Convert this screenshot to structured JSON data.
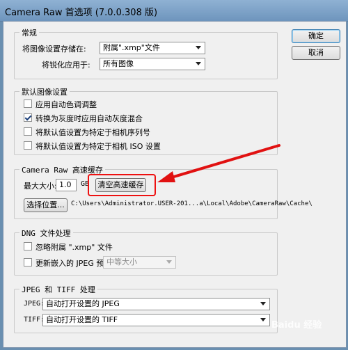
{
  "window": {
    "title": "Camera Raw 首选项 (7.0.0.308 版)"
  },
  "buttons": {
    "ok": "确定",
    "cancel": "取消"
  },
  "general": {
    "legend": "常规",
    "save_label": "将图像设置存储在:",
    "save_value": "附属\".xmp\"文件",
    "sharpen_label": "将锐化应用于:",
    "sharpen_value": "所有图像"
  },
  "defaults": {
    "legend": "默认图像设置",
    "items": [
      {
        "label": "应用自动色调调整",
        "checked": false
      },
      {
        "label": "转换为灰度时应用自动灰度混合",
        "checked": true
      },
      {
        "label": "将默认值设置为特定于相机序列号",
        "checked": false
      },
      {
        "label": "将默认值设置为特定于相机 ISO 设置",
        "checked": false
      }
    ]
  },
  "cache": {
    "legend": "Camera Raw 高速缓存",
    "max_size_label": "最大大小:",
    "max_size_value": "1.0",
    "unit": "GB",
    "purge_button": "清空高速缓存",
    "select_button": "选择位置...",
    "path": "C:\\Users\\Administrator.USER-201...a\\Local\\Adobe\\CameraRaw\\Cache\\"
  },
  "dng": {
    "legend": "DNG 文件处理",
    "ignore_label": "忽略附属 \".xmp\" 文件",
    "update_label": "更新嵌入的 JPEG 预览:",
    "preview_value": "中等大小"
  },
  "jpeg_tiff": {
    "legend": "JPEG 和 TIFF 处理",
    "jpeg_label": "JPEG:",
    "jpeg_value": "自动打开设置的 JPEG",
    "tiff_label": "TIFF:",
    "tiff_value": "自动打开设置的 TIFF"
  },
  "watermark": {
    "text": "Baidu 经验"
  },
  "annotation": {
    "color": "#e11111"
  }
}
